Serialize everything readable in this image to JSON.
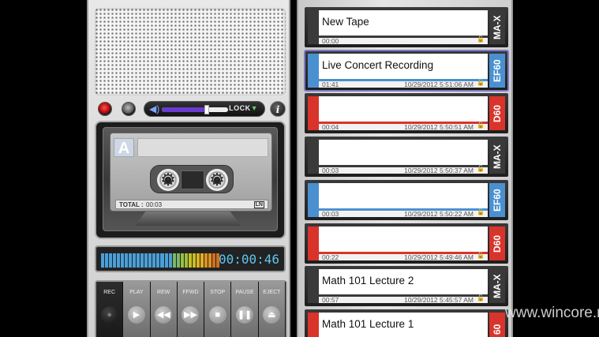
{
  "recorder": {
    "volume": {
      "level": 0.68,
      "lock_label": "LOCK"
    },
    "info_label": "i",
    "cassette": {
      "side": "A",
      "total_label": "TOTAL :",
      "total_value": "00:03",
      "logo": "LN"
    },
    "meter": {
      "levels": [
        0.9,
        0.9,
        0.9,
        0.9,
        0.9,
        0.9,
        0.9,
        0.9,
        0.9,
        0.9,
        0.9,
        0.9,
        0.9,
        0.9,
        0.9,
        0.9,
        0.9,
        0.9,
        0.9,
        0.9,
        0.9,
        0.9,
        0.9,
        0.9,
        0.9,
        0.9,
        0.9,
        0.9,
        0.9,
        0.9
      ],
      "colors": [
        "#4a9fd8",
        "#4a9fd8",
        "#4a9fd8",
        "#4a9fd8",
        "#4a9fd8",
        "#4a9fd8",
        "#4a9fd8",
        "#4a9fd8",
        "#4a9fd8",
        "#4a9fd8",
        "#4a9fd8",
        "#4a9fd8",
        "#4a9fd8",
        "#4a9fd8",
        "#4a9fd8",
        "#4a9fd8",
        "#4a9fd8",
        "#4a9fd8",
        "#7ab86a",
        "#7ab86a",
        "#9ac040",
        "#9ac040",
        "#c8c020",
        "#c8c020",
        "#e0b020",
        "#e0b020",
        "#e09020",
        "#e09020",
        "#d07020",
        "#d07020"
      ],
      "timer": "00:00:46"
    },
    "transport": [
      {
        "label": "REC",
        "icon": "record-icon",
        "glyph": "●"
      },
      {
        "label": "PLAY",
        "icon": "play-icon",
        "glyph": "▶"
      },
      {
        "label": "REW",
        "icon": "rewind-icon",
        "glyph": "◀◀"
      },
      {
        "label": "FFWD",
        "icon": "fast-forward-icon",
        "glyph": "▶▶"
      },
      {
        "label": "STOP",
        "icon": "stop-icon",
        "glyph": "■"
      },
      {
        "label": "PAUSE",
        "icon": "pause-icon",
        "glyph": "❚❚"
      },
      {
        "label": "EJECT",
        "icon": "eject-icon",
        "glyph": "⏏"
      }
    ]
  },
  "tapes": [
    {
      "title": "New Tape",
      "duration": "00:00",
      "date": "",
      "type": "MA-X",
      "color": "#3a3a3a",
      "accent": "#3a3a3a"
    },
    {
      "title": "Live Concert Recording",
      "duration": "01:41",
      "date": "10/29/2012 5:51:06 AM",
      "type": "EF60",
      "color": "#4a90d0",
      "accent": "#4a90d0",
      "selected": true
    },
    {
      "title": "",
      "duration": "00:04",
      "date": "10/29/2012 5:50:51 AM",
      "type": "D60",
      "color": "#d9342b",
      "accent": "#d9342b"
    },
    {
      "title": "",
      "duration": "00:03",
      "date": "10/29/2012 5:50:37 AM",
      "type": "MA-X",
      "color": "#3a3a3a",
      "accent": "#3a3a3a"
    },
    {
      "title": "",
      "duration": "00:03",
      "date": "10/29/2012 5:50:22 AM",
      "type": "EF60",
      "color": "#4a90d0",
      "accent": "#4a90d0"
    },
    {
      "title": "",
      "duration": "00:22",
      "date": "10/29/2012 5:49:46 AM",
      "type": "D60",
      "color": "#d9342b",
      "accent": "#d9342b"
    },
    {
      "title": "Math 101 Lecture 2",
      "duration": "00:57",
      "date": "10/29/2012 5:45:57 AM",
      "type": "MA-X",
      "color": "#3a3a3a",
      "accent": "#3a3a3a"
    },
    {
      "title": "Math 101 Lecture 1",
      "duration": "",
      "date": "",
      "type": "60",
      "color": "#d9342b",
      "accent": "#d9342b"
    }
  ],
  "watermark": "www.wincore.ru"
}
